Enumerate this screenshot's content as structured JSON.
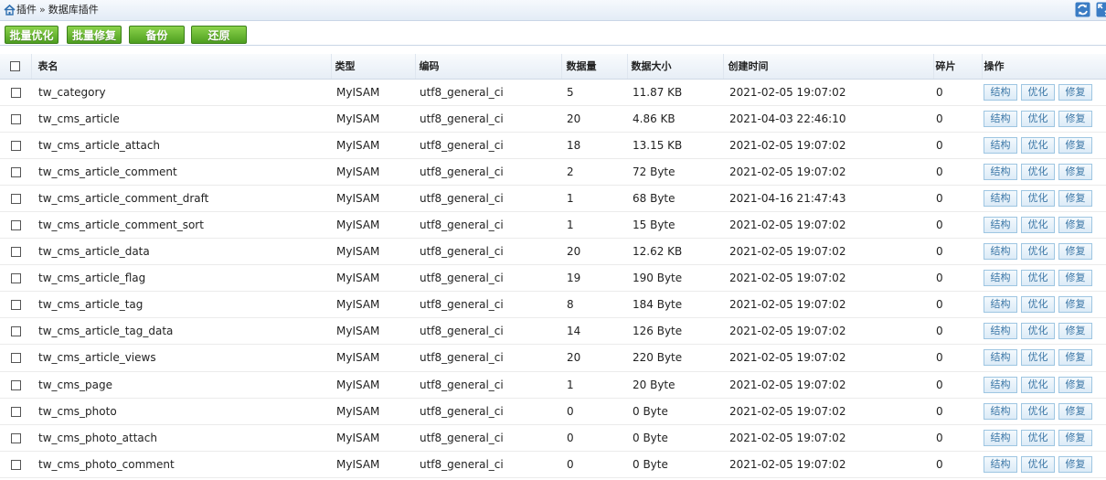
{
  "breadcrumb": {
    "parent": "插件",
    "separator": "»",
    "current": "数据库插件"
  },
  "toolbar": {
    "optimize_all": "批量优化",
    "repair_all": "批量修复",
    "backup": "备份",
    "restore": "还原"
  },
  "columns": {
    "name": "表名",
    "type": "类型",
    "collation": "编码",
    "rows": "数据量",
    "size": "数据大小",
    "created": "创建时间",
    "fragment": "碎片",
    "actions": "操作"
  },
  "actions": {
    "structure": "结构",
    "optimize": "优化",
    "repair": "修复"
  },
  "rows": [
    {
      "name": "tw_category",
      "type": "MyISAM",
      "collation": "utf8_general_ci",
      "rows": "5",
      "size": "11.87 KB",
      "created": "2021-02-05 19:07:02",
      "fragment": "0"
    },
    {
      "name": "tw_cms_article",
      "type": "MyISAM",
      "collation": "utf8_general_ci",
      "rows": "20",
      "size": "4.86 KB",
      "created": "2021-04-03 22:46:10",
      "fragment": "0"
    },
    {
      "name": "tw_cms_article_attach",
      "type": "MyISAM",
      "collation": "utf8_general_ci",
      "rows": "18",
      "size": "13.15 KB",
      "created": "2021-02-05 19:07:02",
      "fragment": "0"
    },
    {
      "name": "tw_cms_article_comment",
      "type": "MyISAM",
      "collation": "utf8_general_ci",
      "rows": "2",
      "size": "72 Byte",
      "created": "2021-02-05 19:07:02",
      "fragment": "0"
    },
    {
      "name": "tw_cms_article_comment_draft",
      "type": "MyISAM",
      "collation": "utf8_general_ci",
      "rows": "1",
      "size": "68 Byte",
      "created": "2021-04-16 21:47:43",
      "fragment": "0"
    },
    {
      "name": "tw_cms_article_comment_sort",
      "type": "MyISAM",
      "collation": "utf8_general_ci",
      "rows": "1",
      "size": "15 Byte",
      "created": "2021-02-05 19:07:02",
      "fragment": "0"
    },
    {
      "name": "tw_cms_article_data",
      "type": "MyISAM",
      "collation": "utf8_general_ci",
      "rows": "20",
      "size": "12.62 KB",
      "created": "2021-02-05 19:07:02",
      "fragment": "0"
    },
    {
      "name": "tw_cms_article_flag",
      "type": "MyISAM",
      "collation": "utf8_general_ci",
      "rows": "19",
      "size": "190 Byte",
      "created": "2021-02-05 19:07:02",
      "fragment": "0"
    },
    {
      "name": "tw_cms_article_tag",
      "type": "MyISAM",
      "collation": "utf8_general_ci",
      "rows": "8",
      "size": "184 Byte",
      "created": "2021-02-05 19:07:02",
      "fragment": "0"
    },
    {
      "name": "tw_cms_article_tag_data",
      "type": "MyISAM",
      "collation": "utf8_general_ci",
      "rows": "14",
      "size": "126 Byte",
      "created": "2021-02-05 19:07:02",
      "fragment": "0"
    },
    {
      "name": "tw_cms_article_views",
      "type": "MyISAM",
      "collation": "utf8_general_ci",
      "rows": "20",
      "size": "220 Byte",
      "created": "2021-02-05 19:07:02",
      "fragment": "0"
    },
    {
      "name": "tw_cms_page",
      "type": "MyISAM",
      "collation": "utf8_general_ci",
      "rows": "1",
      "size": "20 Byte",
      "created": "2021-02-05 19:07:02",
      "fragment": "0"
    },
    {
      "name": "tw_cms_photo",
      "type": "MyISAM",
      "collation": "utf8_general_ci",
      "rows": "0",
      "size": "0 Byte",
      "created": "2021-02-05 19:07:02",
      "fragment": "0"
    },
    {
      "name": "tw_cms_photo_attach",
      "type": "MyISAM",
      "collation": "utf8_general_ci",
      "rows": "0",
      "size": "0 Byte",
      "created": "2021-02-05 19:07:02",
      "fragment": "0"
    },
    {
      "name": "tw_cms_photo_comment",
      "type": "MyISAM",
      "collation": "utf8_general_ci",
      "rows": "0",
      "size": "0 Byte",
      "created": "2021-02-05 19:07:02",
      "fragment": "0"
    }
  ],
  "colors": {
    "button_green": "#4e9f20",
    "action_border": "#9ec6e2",
    "action_text": "#3a76a6",
    "topbar": "#e3ecf6"
  }
}
